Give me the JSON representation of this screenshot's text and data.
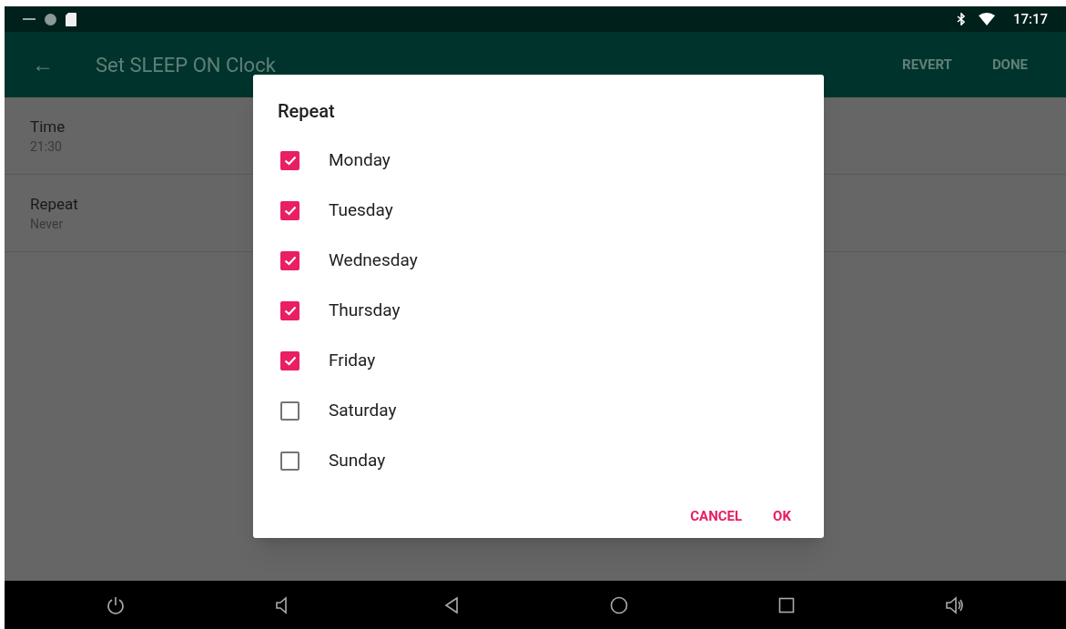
{
  "status_bar": {
    "time": "17:17"
  },
  "app_bar": {
    "back": "←",
    "title": "Set SLEEP ON Clock",
    "actions": [
      "REVERT",
      "DONE"
    ]
  },
  "settings": [
    {
      "label": "Time",
      "value": "21:30"
    },
    {
      "label": "Repeat",
      "value": "Never"
    }
  ],
  "dialog": {
    "title": "Repeat",
    "days": [
      {
        "label": "Monday",
        "checked": true
      },
      {
        "label": "Tuesday",
        "checked": true
      },
      {
        "label": "Wednesday",
        "checked": true
      },
      {
        "label": "Thursday",
        "checked": true
      },
      {
        "label": "Friday",
        "checked": true
      },
      {
        "label": "Saturday",
        "checked": false
      },
      {
        "label": "Sunday",
        "checked": false
      }
    ],
    "buttons": [
      "CANCEL",
      "OK"
    ]
  }
}
